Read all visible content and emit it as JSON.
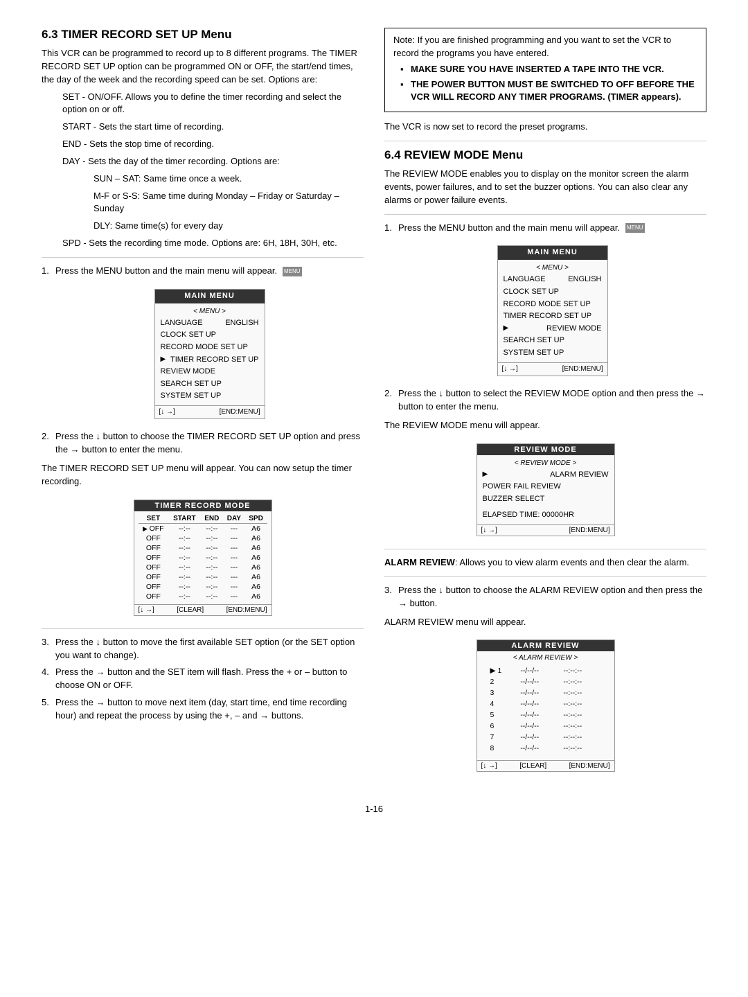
{
  "left_col": {
    "section_num": "6.3",
    "title": "TIMER RECORD SET UP Menu",
    "intro": "This VCR can be programmed to record up to 8 different programs. The TIMER RECORD SET UP option can be programmed ON or OFF, the start/end times, the day of the week and the recording speed can be set. Options are:",
    "options": [
      "SET - ON/OFF.  Allows you to define the timer recording and select the option on or off.",
      "START - Sets the start time of recording.",
      "END - Sets the stop time of recording.",
      "DAY - Sets the day of the timer recording. Options are:",
      "SUN – SAT: Same time once a week.",
      "M-F or S-S: Same time during Monday – Friday or Saturday – Sunday",
      "DLY: Same time(s) for every day",
      "SPD - Sets the recording time mode. Options are: 6H, 18H, 30H, etc."
    ],
    "step1": "Press the MENU button and the main menu will appear.",
    "main_menu_label": "MAIN MENU",
    "main_menu_submenu": "< MENU >",
    "main_menu_items": [
      {
        "label": "LANGUAGE",
        "value": "ENGLISH",
        "active": false
      },
      {
        "label": "CLOCK SET UP",
        "value": "",
        "active": false
      },
      {
        "label": "RECORD MODE SET UP",
        "value": "",
        "active": false
      },
      {
        "label": "TIMER RECORD SET UP",
        "value": "",
        "active": true
      },
      {
        "label": "REVIEW MODE",
        "value": "",
        "active": false
      },
      {
        "label": "SEARCH SET UP",
        "value": "",
        "active": false
      },
      {
        "label": "SYSTEM  SET UP",
        "value": "",
        "active": false
      }
    ],
    "main_menu_footer_left": "[↓  →]",
    "main_menu_footer_right": "[END:MENU]",
    "step2": "Press the ↓ button to choose the TIMER RECORD SET UP option and press the → button to enter the menu.",
    "timer_intro": "The TIMER RECORD SET UP menu will appear. You can now setup the timer recording.",
    "timer_box_title": "TIMER RECORD MODE",
    "timer_table_headers": [
      "SET",
      "START",
      "END",
      "DAY",
      "SPD"
    ],
    "timer_table_rows": [
      {
        "set": "OFF",
        "start": "--:--",
        "end": "--:--",
        "day": "---",
        "spd": "A6",
        "active": true
      },
      {
        "set": "OFF",
        "start": "--:--",
        "end": "--:--",
        "day": "---",
        "spd": "A6",
        "active": false
      },
      {
        "set": "OFF",
        "start": "--:--",
        "end": "--:--",
        "day": "---",
        "spd": "A6",
        "active": false
      },
      {
        "set": "OFF",
        "start": "--:--",
        "end": "--:--",
        "day": "---",
        "spd": "A6",
        "active": false
      },
      {
        "set": "OFF",
        "start": "--:--",
        "end": "--:--",
        "day": "---",
        "spd": "A6",
        "active": false
      },
      {
        "set": "OFF",
        "start": "--:--",
        "end": "--:--",
        "day": "---",
        "spd": "A6",
        "active": false
      },
      {
        "set": "OFF",
        "start": "--:--",
        "end": "--:--",
        "day": "---",
        "spd": "A6",
        "active": false
      },
      {
        "set": "OFF",
        "start": "--:--",
        "end": "--:--",
        "day": "---",
        "spd": "A6",
        "active": false
      }
    ],
    "timer_footer_left": "[↓  →]",
    "timer_footer_clear": "[CLEAR]",
    "timer_footer_right": "[END:MENU]",
    "step3": "Press the ↓ button to move the first available SET option (or the SET option you want to change).",
    "step4": "Press the → button and the SET item will flash.  Press the + or – button to choose ON or OFF.",
    "step5": "Press the → button to move next item (day, start time, end time recording hour) and repeat the process by using the +, – and → buttons."
  },
  "right_col": {
    "note_bold_intro": "Note: If you are finished programming and you want to set the VCR to record the programs you have entered.",
    "note_bullet1": "MAKE SURE YOU HAVE INSERTED A TAPE INTO THE VCR.",
    "note_bullet2": "THE POWER BUTTON MUST BE SWITCHED TO OFF BEFORE THE VCR WILL RECORD ANY TIMER PROGRAMS. (TIMER appears).",
    "vcr_note": "The VCR is now set to record the preset programs.",
    "section_num": "6.4",
    "title": "REVIEW MODE Menu",
    "review_intro": "The REVIEW MODE enables you to display on the monitor screen the alarm events, power failures, and to set the buzzer options.  You can also clear any alarms or power failure events.",
    "step1": "Press the MENU button and the main menu will appear.",
    "main_menu_label": "MAIN MENU",
    "main_menu_submenu": "< MENU >",
    "main_menu_items": [
      {
        "label": "LANGUAGE",
        "value": "ENGLISH",
        "active": false
      },
      {
        "label": "CLOCK SET UP",
        "value": "",
        "active": false
      },
      {
        "label": "RECORD MODE SET UP",
        "value": "",
        "active": false
      },
      {
        "label": "TIMER RECORD SET UP",
        "value": "",
        "active": false
      },
      {
        "label": "REVIEW MODE",
        "value": "",
        "active": true
      },
      {
        "label": "SEARCH SET UP",
        "value": "",
        "active": false
      },
      {
        "label": "SYSTEM SET UP",
        "value": "",
        "active": false
      }
    ],
    "main_menu_footer_left": "[↓  →]",
    "main_menu_footer_right": "[END:MENU]",
    "step2": "Press the ↓ button to select the REVIEW MODE option and then press the → button to enter the menu.",
    "review_mode_note": "The REVIEW MODE menu will appear.",
    "review_box_title": "REVIEW MODE",
    "review_box_submenu": "< REVIEW MODE >",
    "review_box_items": [
      {
        "label": "ALARM REVIEW",
        "active": true
      },
      {
        "label": "POWER FAIL REVIEW",
        "active": false
      },
      {
        "label": "BUZZER SELECT",
        "active": false
      }
    ],
    "review_box_elapsed": "ELAPSED TIME: 00000HR",
    "review_box_footer_left": "[↓  →]",
    "review_box_footer_right": "[END:MENU]",
    "alarm_review_title": "ALARM REVIEW",
    "alarm_review_desc": ": Allows you to view alarm events and then clear the alarm.",
    "step3": "Press the ↓ button to choose the ALARM REVIEW option and then press the → button.",
    "alarm_menu_note": "ALARM REVIEW menu will appear.",
    "alarm_box_submenu": "< ALARM REVIEW >",
    "alarm_table_rows": [
      {
        "num": "1",
        "col1": "--/--/--",
        "col2": "--:--:--",
        "active": true
      },
      {
        "num": "2",
        "col1": "--/--/--",
        "col2": "--:--:--",
        "active": false
      },
      {
        "num": "3",
        "col1": "--/--/--",
        "col2": "--:--:--",
        "active": false
      },
      {
        "num": "4",
        "col1": "--/--/--",
        "col2": "--:--:--",
        "active": false
      },
      {
        "num": "5",
        "col1": "--/--/--",
        "col2": "--:--:--",
        "active": false
      },
      {
        "num": "6",
        "col1": "--/--/--",
        "col2": "--:--:--",
        "active": false
      },
      {
        "num": "7",
        "col1": "--/--/--",
        "col2": "--:--:--",
        "active": false
      },
      {
        "num": "8",
        "col1": "--/--/--",
        "col2": "--:--:--",
        "active": false
      }
    ],
    "alarm_footer_left": "[↓  →]",
    "alarm_footer_clear": "[CLEAR]",
    "alarm_footer_right": "[END:MENU]"
  },
  "page_number": "1-16"
}
